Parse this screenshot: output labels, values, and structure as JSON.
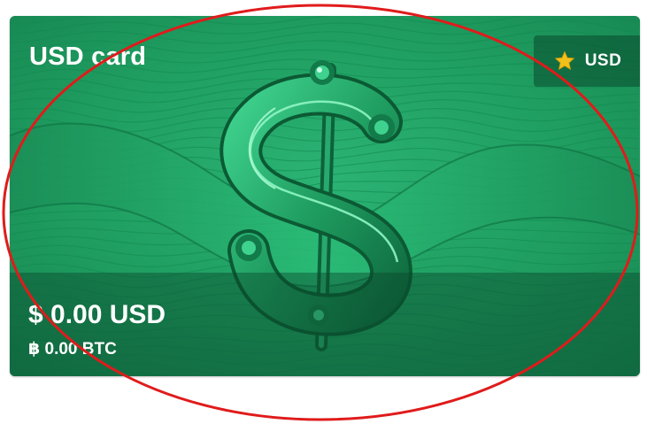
{
  "card": {
    "title": "USD card",
    "badge": {
      "icon": "star-icon",
      "label": "USD",
      "star_color": "#f2c01a"
    },
    "balance": {
      "primary": "$ 0.00 USD",
      "secondary": "฿ 0.00 BTC"
    },
    "artwork": "dollar-sign-icon",
    "colors": {
      "card_green": "#1f9a5d",
      "dark_green": "#0b5a36",
      "highlight_green": "#7ff0b8"
    }
  },
  "annotation": {
    "shape": "ellipse",
    "color": "#e01b1b"
  }
}
